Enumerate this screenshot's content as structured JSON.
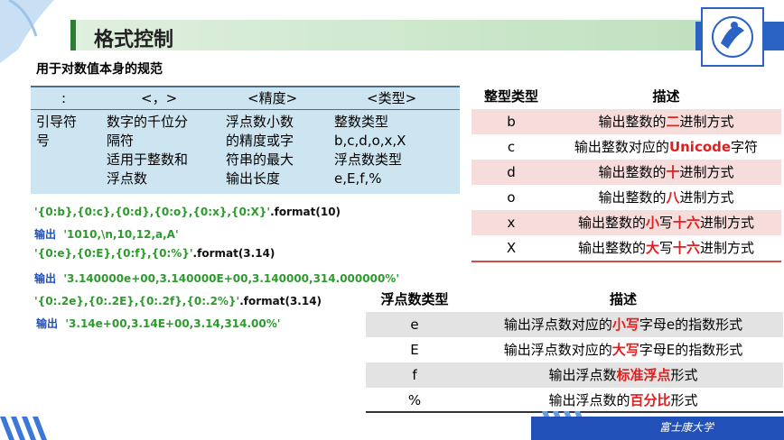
{
  "header": {
    "title": "格式控制",
    "subtitle": "用于对数值本身的规范"
  },
  "format_table": {
    "headers": [
      ":",
      "<，>",
      "<精度>",
      "<类型>"
    ],
    "cells": [
      [
        "引导符",
        "号"
      ],
      [
        "数字的千位分",
        "隔符",
        "适用于整数和",
        "浮点数"
      ],
      [
        "浮点数小数",
        "的精度或字",
        "符串的最大",
        "输出长度"
      ],
      [
        "整数类型",
        "b,c,d,o,x,X",
        "浮点数类型",
        "e,E,f,%"
      ]
    ]
  },
  "code": {
    "line1_str": "'{0:b},{0:c},{0:d},{0:o},{0:x},{0:X}'",
    "line1_call": ".format(10)",
    "out_label": "输出",
    "line2_out": "'1010,\\n,10,12,a,A'",
    "line3_str": "'{0:e},{0:E},{0:f},{0:%}'",
    "line3_call": ".format(3.14)",
    "line4_out": "'3.140000e+00,3.140000E+00,3.140000,314.000000%'",
    "line5_str": "'{0:.2e},{0:.2E},{0:.2f},{0:.2%}'",
    "line5_call": ".format(3.14)",
    "line6_out": "'3.14e+00,3.14E+00,3.14,314.00%'"
  },
  "int_table": {
    "headers": [
      "整型类型",
      "描述"
    ],
    "rows": [
      {
        "type": "b",
        "pre": "输出整数的",
        "em": "二",
        "post": "进制方式"
      },
      {
        "type": "c",
        "pre": "输出整数对应的",
        "em": "Unicode",
        "post": "字符"
      },
      {
        "type": "d",
        "pre": "输出整数的",
        "em": "十",
        "post": "进制方式"
      },
      {
        "type": "o",
        "pre": "输出整数的",
        "em": "八",
        "post": "进制方式"
      },
      {
        "type": "x",
        "pre": "输出整数的",
        "em": "小",
        "mid": "写",
        "em2": "十六",
        "post": "进制方式"
      },
      {
        "type": "X",
        "pre": "输出整数的",
        "em": "大",
        "mid": "写",
        "em2": "十六",
        "post": "进制方式"
      }
    ]
  },
  "float_table": {
    "headers": [
      "浮点数类型",
      "描述"
    ],
    "rows": [
      {
        "type": "e",
        "pre": "输出浮点数对应的",
        "em": "小写",
        "post": "字母e的指数形式"
      },
      {
        "type": "E",
        "pre": "输出浮点数对应的",
        "em": "大写",
        "post": "字母E的指数形式"
      },
      {
        "type": "f",
        "pre": "输出浮点数",
        "em": "标准浮点",
        "post": "形式"
      },
      {
        "type": "%",
        "pre": "输出浮点数的",
        "em": "百分比",
        "post": "形式"
      }
    ]
  },
  "footer": {
    "text": "富士康大学"
  },
  "colors": {
    "accent": "#2b63c4",
    "green": "#2e9a2e",
    "red": "#e02020"
  }
}
